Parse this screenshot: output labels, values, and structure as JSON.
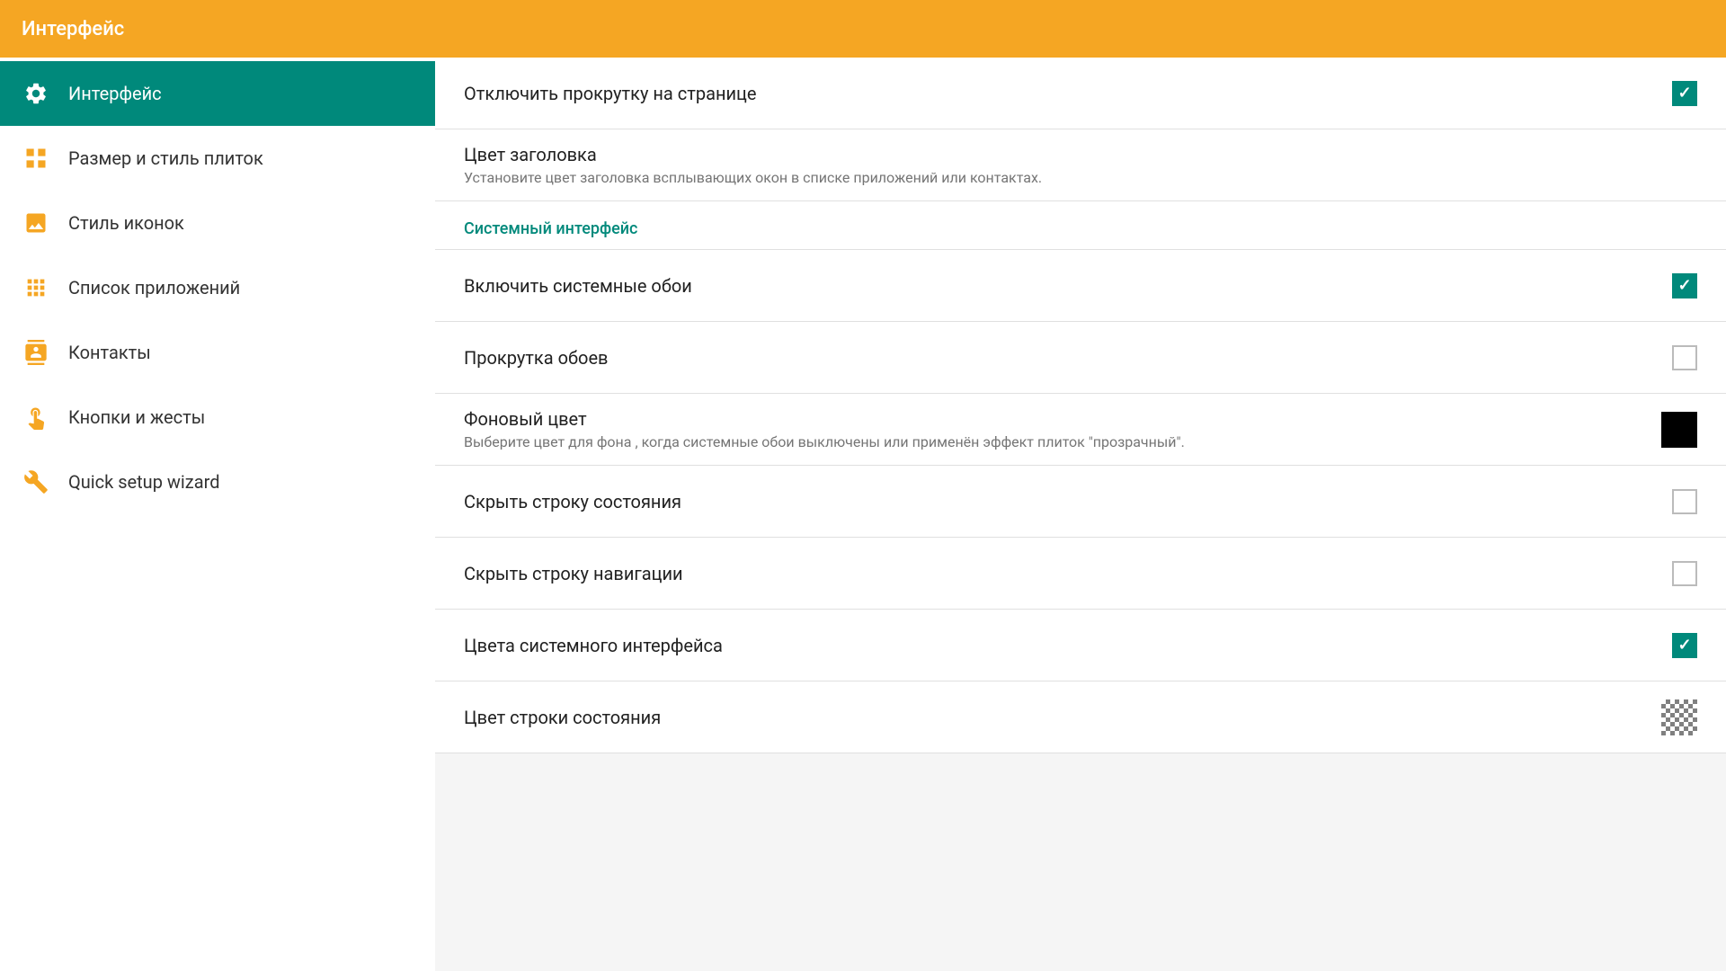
{
  "header": {
    "title": "Интерфейс"
  },
  "sidebar": {
    "items": [
      {
        "id": "interface",
        "label": "Интерфейс",
        "active": true,
        "icon": "gear"
      },
      {
        "id": "tile-size",
        "label": "Размер и стиль плиток",
        "active": false,
        "icon": "tile"
      },
      {
        "id": "icon-style",
        "label": "Стиль иконок",
        "active": false,
        "icon": "photo"
      },
      {
        "id": "app-list",
        "label": "Список приложений",
        "active": false,
        "icon": "grid"
      },
      {
        "id": "contacts",
        "label": "Контакты",
        "active": false,
        "icon": "contacts"
      },
      {
        "id": "buttons",
        "label": "Кнопки и жесты",
        "active": false,
        "icon": "gestures"
      },
      {
        "id": "wizard",
        "label": "Quick setup wizard",
        "active": false,
        "icon": "wrench"
      }
    ]
  },
  "content": {
    "section_system_ui": "Системный интерфейс",
    "settings": [
      {
        "id": "disable-scroll",
        "title": "Отключить прокрутку на странице",
        "subtitle": "",
        "control": "checkbox",
        "checked": true
      },
      {
        "id": "header-color",
        "title": "Цвет заголовка",
        "subtitle": "Установите цвет заголовка всплывающих окон в списке приложений или контактах.",
        "control": "none",
        "checked": false
      },
      {
        "id": "system-wallpaper",
        "title": "Включить системные обои",
        "subtitle": "",
        "control": "checkbox",
        "checked": true,
        "section_before": "Системный интерфейс"
      },
      {
        "id": "wallpaper-scroll",
        "title": "Прокрутка обоев",
        "subtitle": "",
        "control": "checkbox",
        "checked": false
      },
      {
        "id": "bg-color",
        "title": "Фоновый цвет",
        "subtitle": "Выберите цвет для фона , когда системные обои выключены или применён эффект плиток \"прозрачный\".",
        "control": "color-black",
        "checked": false
      },
      {
        "id": "hide-statusbar",
        "title": "Скрыть строку состояния",
        "subtitle": "",
        "control": "checkbox",
        "checked": false
      },
      {
        "id": "hide-navbar",
        "title": "Скрыть строку навигации",
        "subtitle": "",
        "control": "checkbox",
        "checked": false
      },
      {
        "id": "system-ui-colors",
        "title": "Цвета системного интерфейса",
        "subtitle": "",
        "control": "checkbox",
        "checked": true
      },
      {
        "id": "statusbar-color",
        "title": "Цвет строки состояния",
        "subtitle": "",
        "control": "color-checker",
        "checked": false
      }
    ]
  }
}
